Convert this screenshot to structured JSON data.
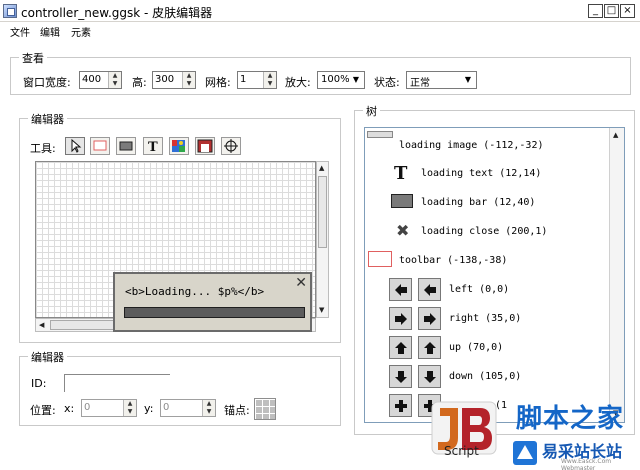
{
  "window": {
    "title": "controller_new.ggsk - 皮肤编辑器"
  },
  "menu": [
    "文件",
    "编辑",
    "元素"
  ],
  "view_group": {
    "title": "查看",
    "width_label": "窗口宽度:",
    "width_value": "400",
    "height_label": "高:",
    "height_value": "300",
    "grid_label": "网格:",
    "grid_value": "1",
    "zoom_label": "放大:",
    "zoom_value": "100%",
    "state_label": "状态:",
    "state_value": "正常"
  },
  "editor": {
    "title": "编辑器",
    "tools_label": "工具:",
    "tool_icons": [
      "pointer-icon",
      "rectangle-icon",
      "filled-rectangle-icon",
      "text-icon",
      "image-icon",
      "button-image-icon",
      "crosshair-icon"
    ],
    "preview": {
      "loading_text": "<b>Loading... $p%</b>"
    }
  },
  "properties": {
    "title": "编辑器",
    "id_label": "ID:",
    "position_label": "位置:",
    "x_label": "x:",
    "x_value": "0",
    "y_label": "y:",
    "y_value": "0",
    "anchor_label": "锚点:"
  },
  "tree": {
    "title": "树",
    "items": [
      {
        "label": "loading image (-112,-32)",
        "icon": "image-icon"
      },
      {
        "label": "loading text (12,14)",
        "icon": "text-icon"
      },
      {
        "label": "loading bar (12,40)",
        "icon": "bar-icon"
      },
      {
        "label": "loading close (200,1)",
        "icon": "close-icon"
      },
      {
        "label": "toolbar (-138,-38)",
        "icon": "rectangle-icon"
      },
      {
        "label": "left (0,0)",
        "icon": "arrow-left-icon"
      },
      {
        "label": "right (35,0)",
        "icon": "arrow-right-icon"
      },
      {
        "label": "up (70,0)",
        "icon": "arrow-up-icon"
      },
      {
        "label": "down (105,0)",
        "icon": "arrow-down-icon"
      },
      {
        "label": "(1",
        "icon": "zoom-in-icon"
      }
    ]
  },
  "watermark": {
    "title": "脚本之家",
    "subtitle": "易采站长站",
    "small": "Www.Easck.Com Webmaster",
    "logo_text": "Script"
  }
}
